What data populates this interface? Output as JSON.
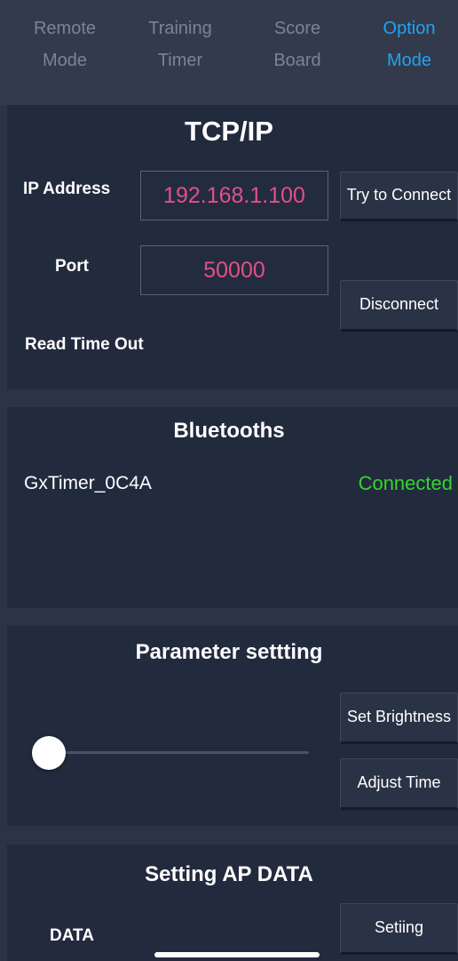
{
  "tabs": [
    {
      "label": "Remote\nMode",
      "active": false
    },
    {
      "label": "Training\nTimer",
      "active": false
    },
    {
      "label": "Score\nBoard",
      "active": false
    },
    {
      "label": "Option\nMode",
      "active": true
    }
  ],
  "tcpip": {
    "title": "TCP/IP",
    "ip_label": "IP Address",
    "ip_value": "192.168.1.100",
    "port_label": "Port",
    "port_value": "50000",
    "read_timeout_label": "Read Time Out",
    "connect_button": "Try to Connect",
    "disconnect_button": "Disconnect"
  },
  "bluetooth": {
    "title": "Bluetooths",
    "device_name": "GxTimer_0C4A",
    "status": "Connected"
  },
  "parameters": {
    "title": "Parameter settting",
    "brightness_button": "Set Brightness",
    "adjust_time_button": "Adjust Time",
    "brightness_level": 0.0
  },
  "ap_data": {
    "title": "Setting AP DATA",
    "data_label": "DATA",
    "setting_button": "Setiing"
  },
  "colors": {
    "accent": "#1ea5f2",
    "field_text": "#e44f86",
    "status_connected": "#35d52c"
  }
}
